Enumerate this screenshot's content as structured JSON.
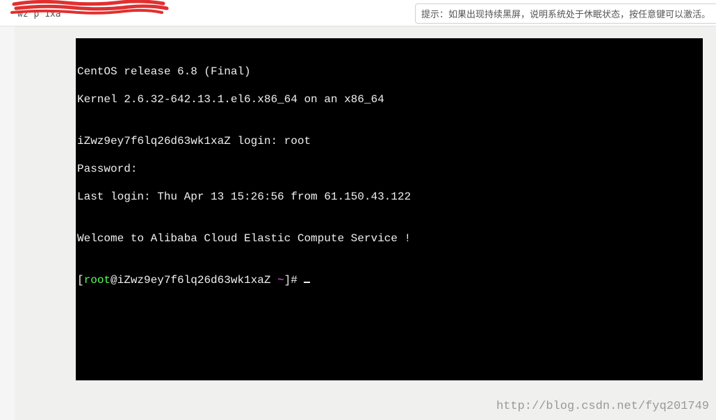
{
  "header": {
    "redacted_partial": "wz    p    1xa",
    "hint": "提示：如果出现持续黑屏，说明系统处于休眠状态，按任意键可以激活。"
  },
  "terminal": {
    "line1": "CentOS release 6.8 (Final)",
    "line2": "Kernel 2.6.32-642.13.1.el6.x86_64 on an x86_64",
    "blank1": "",
    "login_line": "iZwz9ey7f6lq26d63wk1xaZ login: root",
    "password_line": "Password:",
    "last_login": "Last login: Thu Apr 13 15:26:56 from 61.150.43.122",
    "blank2": "",
    "welcome": "Welcome to Alibaba Cloud Elastic Compute Service !",
    "blank3": "",
    "prompt": {
      "bracket_open": "[",
      "user": "root",
      "host": "@iZwz9ey7f6lq26d63wk1xaZ ",
      "tilde": "~",
      "bracket_close": "]# "
    }
  },
  "watermark": "http://blog.csdn.net/fyq201749"
}
